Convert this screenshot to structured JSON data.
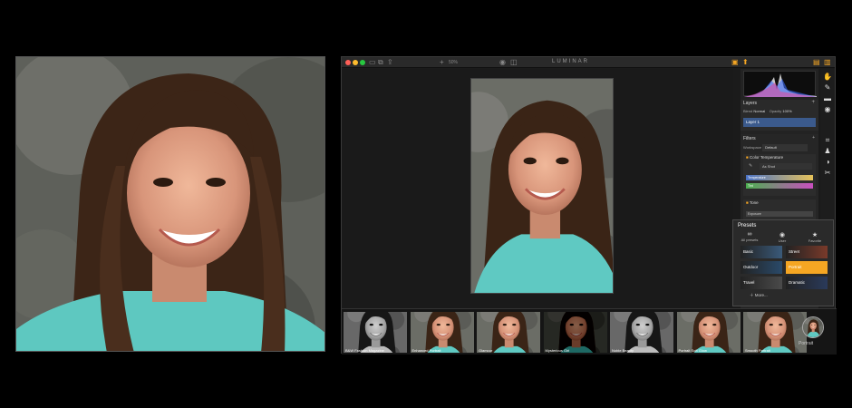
{
  "app": {
    "title": "LUMINAR",
    "zoom": "50%"
  },
  "colors": {
    "accent": "#f5a623",
    "panel": "#232323",
    "selection": "#3b5a8c"
  },
  "layers": {
    "title": "Layers",
    "blend_label": "Blend",
    "blend_value": "Normal",
    "opacity_label": "Opacity",
    "opacity_value": "100%",
    "layer_name": "Layer 1"
  },
  "filters": {
    "title": "Filters",
    "workspace_label": "Workspace",
    "workspace_value": "Default",
    "color_temperature": {
      "title": "Color Temperature",
      "mode": "As Shot",
      "temperature_label": "Temperature",
      "tint_label": "Tint"
    },
    "tone": {
      "title": "Tone",
      "exposure_label": "Exposure"
    }
  },
  "presets": {
    "title": "Presets",
    "categories": [
      {
        "label": "All presets",
        "icon": "infinity-icon"
      },
      {
        "label": "User",
        "icon": "user-icon"
      },
      {
        "label": "Favorite",
        "icon": "star-icon"
      }
    ],
    "tiles": [
      {
        "label": "Basic",
        "selected": false
      },
      {
        "label": "Street",
        "selected": false
      },
      {
        "label": "Outdoor",
        "selected": false
      },
      {
        "label": "Portrait",
        "selected": true
      },
      {
        "label": "Travel",
        "selected": false
      },
      {
        "label": "Dramatic",
        "selected": false
      }
    ],
    "more_label": "More..."
  },
  "filmstrip": {
    "thumbs": [
      {
        "label": "B&W Fashion Magazine",
        "tone": "bw"
      },
      {
        "label": "Enhanced Portrait",
        "tone": "color"
      },
      {
        "label": "Glamour",
        "tone": "color"
      },
      {
        "label": "Mysterious Girl",
        "tone": "dark"
      },
      {
        "label": "Noble Beauty",
        "tone": "bw"
      },
      {
        "label": "Portrait Soft Glow",
        "tone": "color"
      },
      {
        "label": "Smooth Portrait",
        "tone": "color"
      }
    ],
    "category_label": "Portrait"
  }
}
